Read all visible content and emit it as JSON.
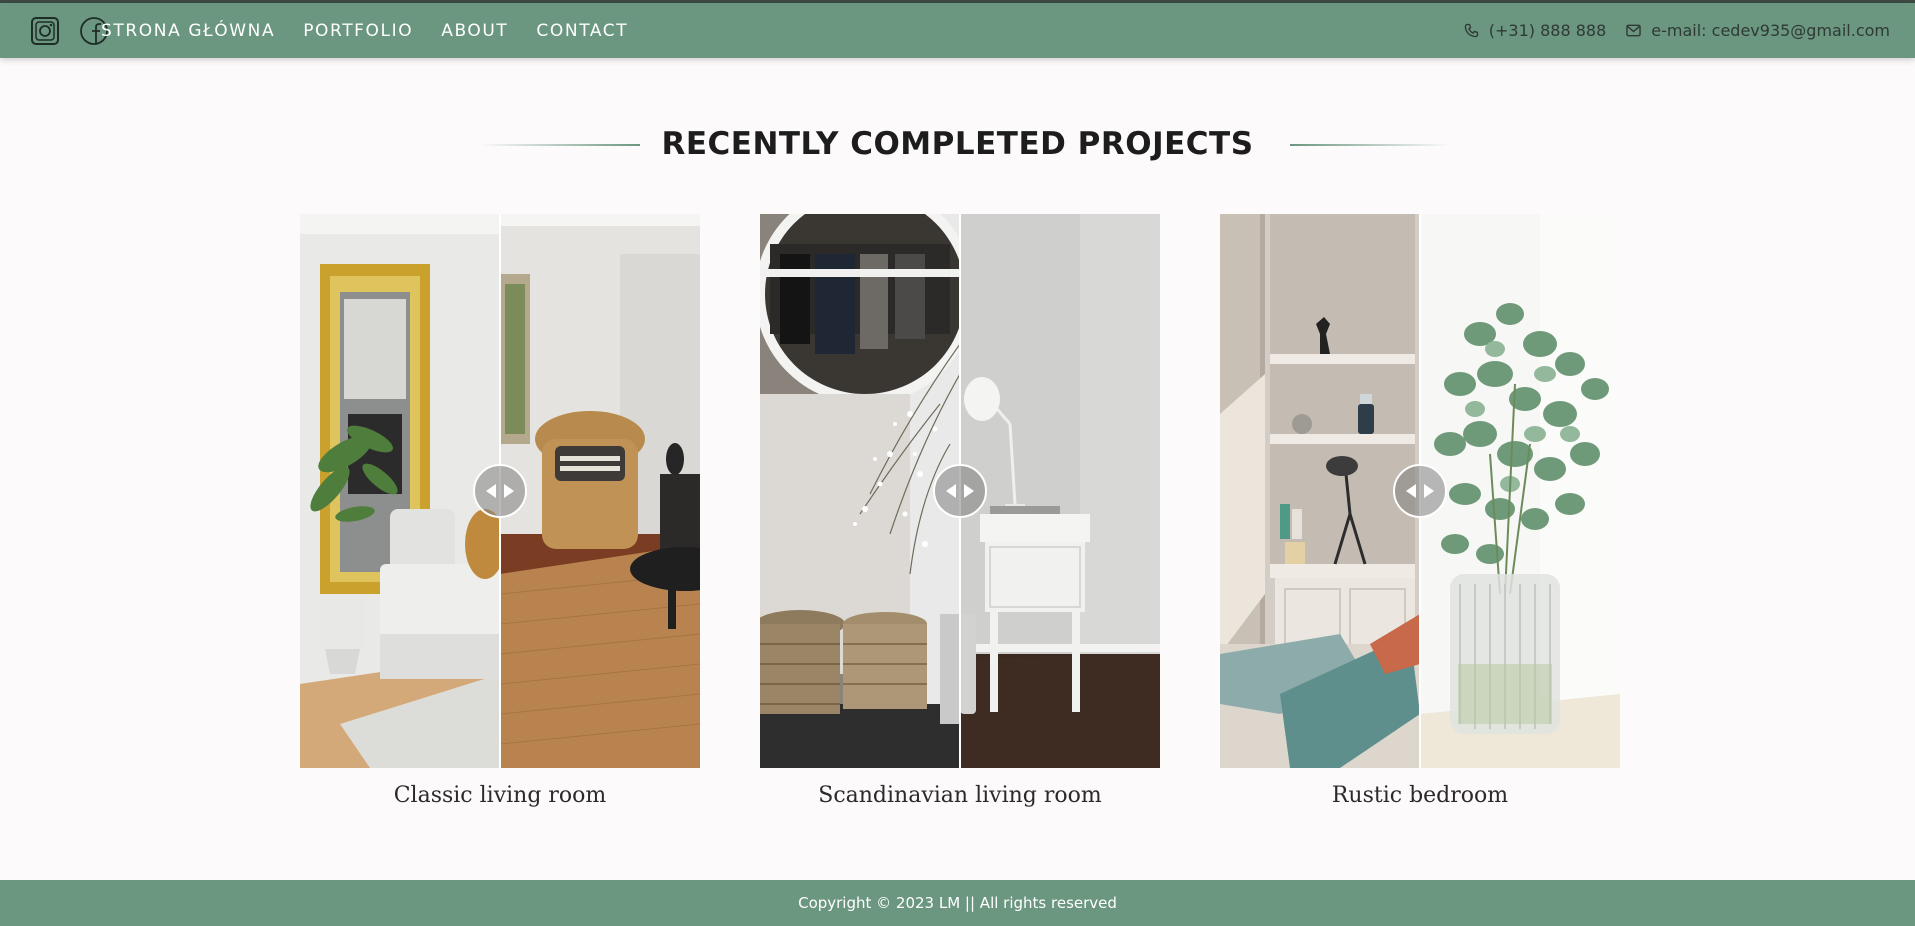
{
  "nav": {
    "links": [
      "STRONA GŁÓWNA",
      "PORTFOLIO",
      "ABOUT",
      "CONTACT"
    ],
    "phone": "(+31) 888 888",
    "email": "e-mail: cedev935@gmail.com",
    "icons": [
      "instagram-icon",
      "facebook-icon",
      "phone-icon",
      "mail-icon"
    ]
  },
  "section": {
    "title": "RECENTLY COMPLETED PROJECTS"
  },
  "projects": [
    {
      "caption": "Classic living room"
    },
    {
      "caption": "Scandinavian living room"
    },
    {
      "caption": "Rustic bedroom"
    }
  ],
  "footer": {
    "copyright": "Copyright © 2023 LM || All rights reserved"
  },
  "colors": {
    "accent": "#6b9680",
    "background": "#fdfafc",
    "title": "#1d1d1d"
  }
}
